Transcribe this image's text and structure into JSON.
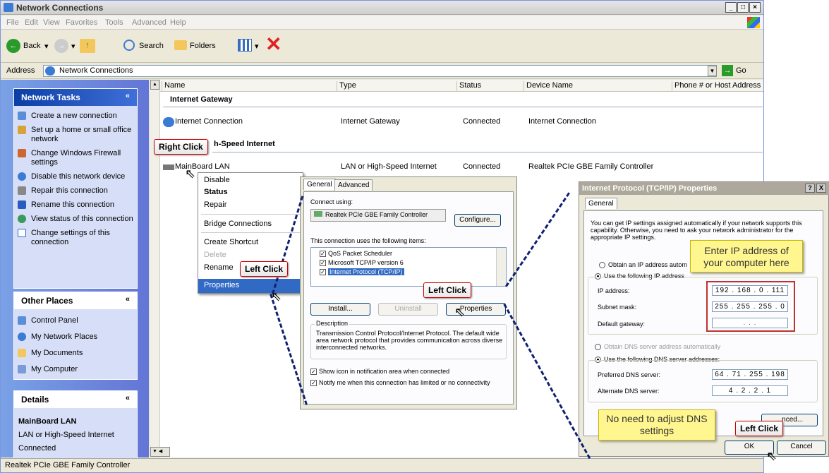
{
  "window": {
    "title": "Network Connections"
  },
  "menu": [
    "File",
    "Edit",
    "View",
    "Favorites",
    "Tools",
    "Advanced",
    "Help"
  ],
  "toolbar": {
    "back": "Back",
    "search": "Search",
    "folders": "Folders"
  },
  "address": {
    "label": "Address",
    "value": "Network Connections",
    "go": "Go"
  },
  "tasks": {
    "title": "Network Tasks",
    "items": [
      "Create a new connection",
      "Set up a home or small office network",
      "Change Windows Firewall settings",
      "Disable this network device",
      "Repair this connection",
      "Rename this connection",
      "View status of this connection",
      "Change settings of this connection"
    ]
  },
  "places": {
    "title": "Other Places",
    "items": [
      "Control Panel",
      "My Network Places",
      "My Documents",
      "My Computer"
    ]
  },
  "details": {
    "title": "Details",
    "name": "MainBoard LAN",
    "type": "LAN or High-Speed Internet",
    "status": "Connected"
  },
  "columns": [
    "Name",
    "Type",
    "Status",
    "Device Name",
    "Phone # or Host Address"
  ],
  "groups": {
    "gateway": "Internet Gateway",
    "lan": "h-Speed Internet"
  },
  "rows": [
    {
      "name": "Internet Connection",
      "type": "Internet Gateway",
      "status": "Connected",
      "device": "Internet Connection"
    },
    {
      "name": "MainBoard LAN",
      "type": "LAN or High-Speed Internet",
      "status": "Connected",
      "device": "Realtek PCIe GBE Family Controller"
    }
  ],
  "context_menu": {
    "disable": "Disable",
    "status": "Status",
    "repair": "Repair",
    "bridge": "Bridge Connections",
    "shortcut": "Create Shortcut",
    "delete": "Delete",
    "rename": "Rename",
    "properties": "Properties"
  },
  "statusbar": "Realtek PCIe GBE Family Controller",
  "props": {
    "tab_general": "General",
    "tab_advanced": "Advanced",
    "connect_using": "Connect using:",
    "adapter": "Realtek PCIe GBE Family Controller",
    "configure": "Configure...",
    "items_label": "This connection uses the following items:",
    "items": [
      "QoS Packet Scheduler",
      "Microsoft TCP/IP version 6",
      "Internet Protocol (TCP/IP)"
    ],
    "install": "Install...",
    "uninstall": "Uninstall",
    "properties": "Properties",
    "desc_title": "Description",
    "desc": "Transmission Control Protocol/Internet Protocol. The default wide area network protocol that provides communication across diverse interconnected networks.",
    "show_icon": "Show icon in notification area when connected",
    "notify": "Notify me when this connection has limited or no connectivity"
  },
  "tcpip": {
    "title": "Internet Protocol (TCP/IP) Properties",
    "help": "?",
    "close": "X",
    "tab": "General",
    "intro": "You can get IP settings assigned automatically if your network supports this capability. Otherwise, you need to ask your network administrator for the appropriate IP settings.",
    "auto_ip": "Obtain an IP address autom",
    "use_ip": "Use the following IP address",
    "ip_label": "IP address:",
    "ip": "192 . 168 . 0 . 111",
    "mask_label": "Subnet mask:",
    "mask": "255 . 255 . 255 . 0",
    "gw_label": "Default gateway:",
    "gw": ". . .",
    "auto_dns": "Obtain DNS server address automatically",
    "use_dns": "Use the following DNS server addresses:",
    "pref_label": "Preferred DNS server:",
    "pref": "64 . 71 . 255 . 198",
    "alt_label": "Alternate DNS server:",
    "alt": "4 . 2 . 2 . 1",
    "advanced": "...nced...",
    "ok": "OK",
    "cancel": "Cancel"
  },
  "callouts": {
    "right_click": "Right Click",
    "left_click": "Left Click"
  },
  "notes": {
    "ip": "Enter IP address of your computer here",
    "dns": "No need to adjust DNS settings"
  }
}
